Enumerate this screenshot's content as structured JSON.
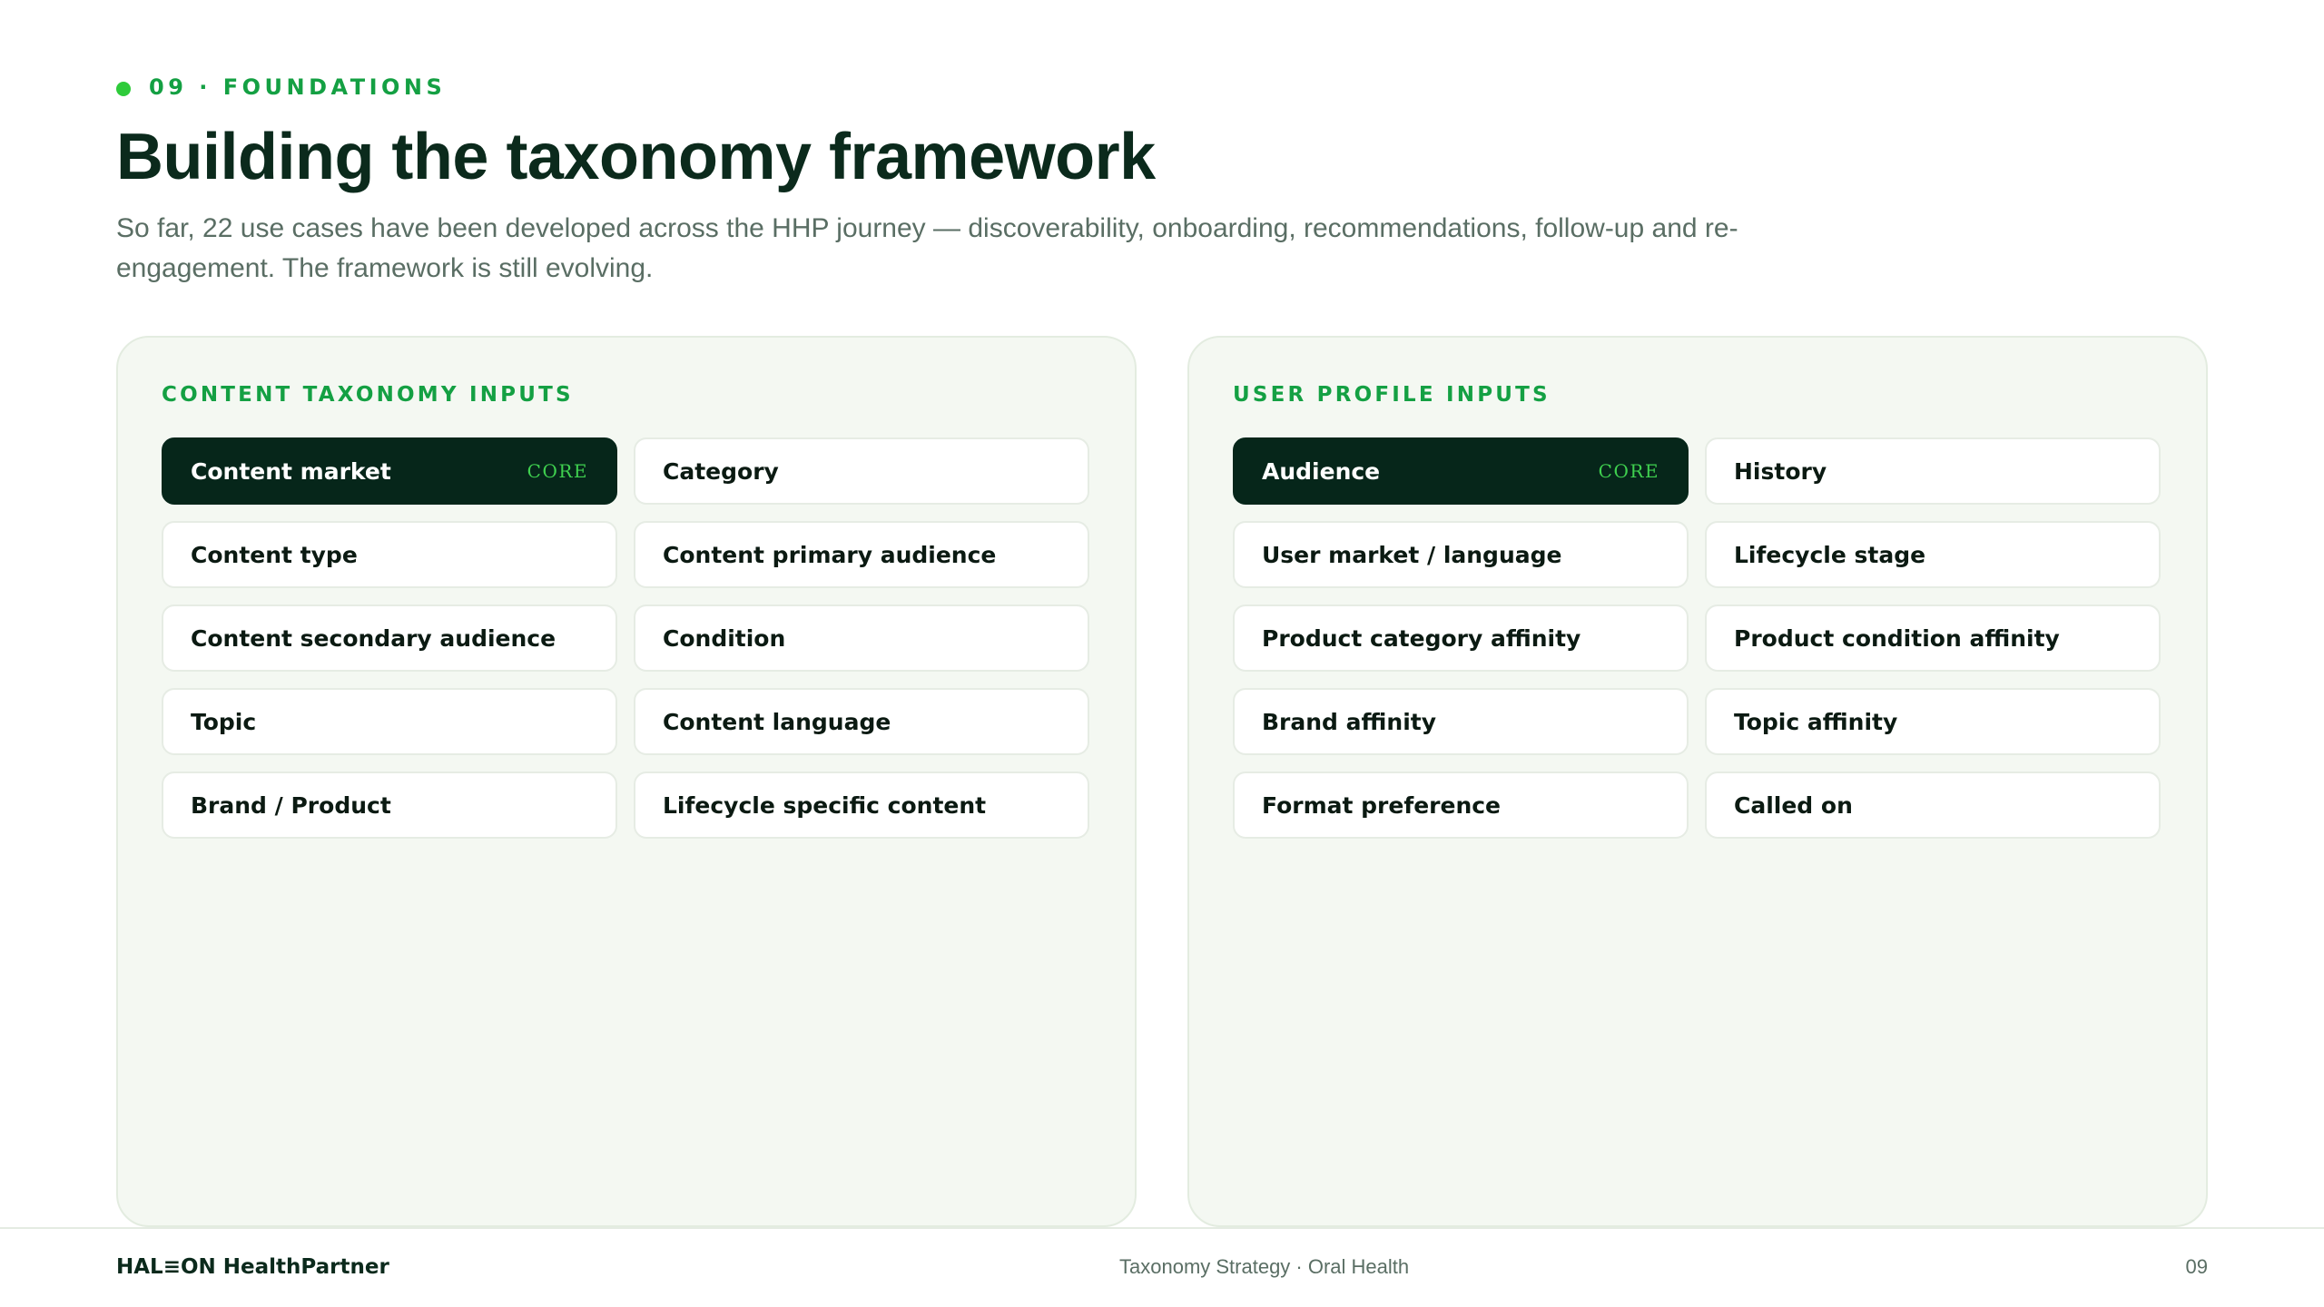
{
  "eyebrow": "09 · FOUNDATIONS",
  "title": "Building the taxonomy framework",
  "subtitle": "So far, 22 use cases have been developed across the HHP journey — discoverability, onboarding, recommendations, follow-up and re-engagement. The framework is still evolving.",
  "colors": {
    "accent": "#14a043",
    "dot": "#2ecb3a",
    "core_bg": "#06261a",
    "panel_bg": "#f4f8f2"
  },
  "content_panel": {
    "title": "CONTENT TAXONOMY INPUTS",
    "items": [
      {
        "label": "Content market",
        "badge": "CORE"
      },
      {
        "label": "Category",
        "badge": ""
      },
      {
        "label": "Content type",
        "badge": ""
      },
      {
        "label": "Content primary audience",
        "badge": ""
      },
      {
        "label": "Content secondary audience",
        "badge": ""
      },
      {
        "label": "Condition",
        "badge": ""
      },
      {
        "label": "Topic",
        "badge": ""
      },
      {
        "label": "Content language",
        "badge": ""
      },
      {
        "label": "Brand / Product",
        "badge": ""
      },
      {
        "label": "Lifecycle specific content",
        "badge": ""
      }
    ]
  },
  "user_panel": {
    "title": "USER PROFILE INPUTS",
    "items": [
      {
        "label": "Audience",
        "badge": "CORE"
      },
      {
        "label": "History",
        "badge": ""
      },
      {
        "label": "User market / language",
        "badge": ""
      },
      {
        "label": "Lifecycle stage",
        "badge": ""
      },
      {
        "label": "Product category affinity",
        "badge": ""
      },
      {
        "label": "Product condition affinity",
        "badge": ""
      },
      {
        "label": "Brand affinity",
        "badge": ""
      },
      {
        "label": "Topic affinity",
        "badge": ""
      },
      {
        "label": "Format preference",
        "badge": ""
      },
      {
        "label": "Called on",
        "badge": ""
      }
    ]
  },
  "footer": {
    "logo": "HAL≡ON HealthPartner",
    "center": "Taxonomy Strategy · Oral Health",
    "page": "09"
  }
}
